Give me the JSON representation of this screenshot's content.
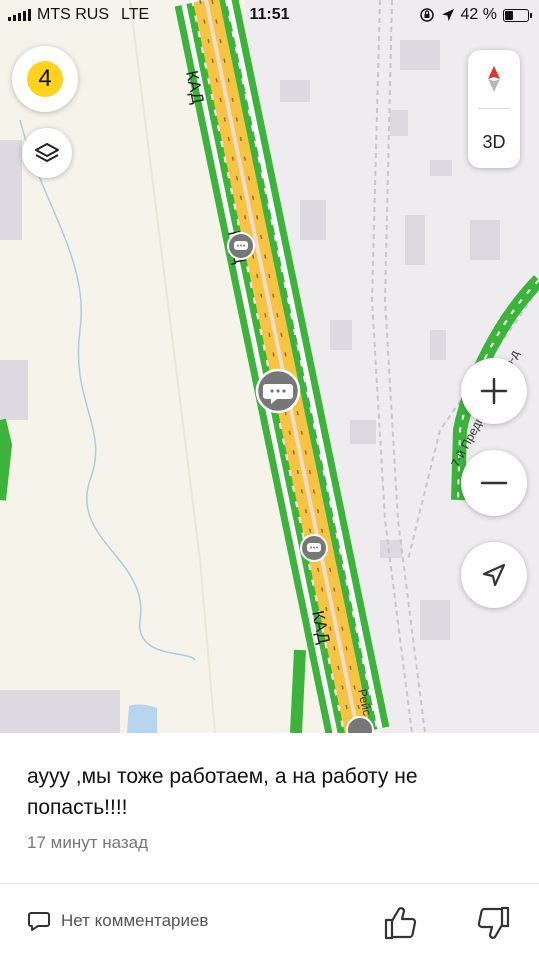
{
  "status_bar": {
    "carrier": "MTS RUS",
    "network": "LTE",
    "time": "11:51",
    "battery_percent_label": "42 %",
    "battery_level": 0.42
  },
  "map": {
    "road_label_1": "КАД",
    "road_label_2": "КАД",
    "road_label_3": "КАД",
    "side_street_label": "7-й Предпортовый пр-д",
    "bottom_street_label": "Рейс",
    "events_count": "4",
    "button_3d": "3D",
    "colors": {
      "traffic_green": "#3cb43c",
      "road_yellow": "#f6c342",
      "events_yellow": "#ffd21f",
      "marker_gray": "#777777"
    }
  },
  "post": {
    "text": "аууу  ,мы тоже работаем, а на работу не попасть!!!!",
    "time_ago": "17 минут назад",
    "comments_label": "Нет комментариев"
  },
  "icons": {
    "layers": "layers-icon",
    "compass": "compass-icon",
    "zoom_in": "plus-icon",
    "zoom_out": "minus-icon",
    "locate": "navigation-arrow-icon",
    "comment": "speech-bubble-icon",
    "like": "thumbs-up-icon",
    "dislike": "thumbs-down-icon"
  }
}
